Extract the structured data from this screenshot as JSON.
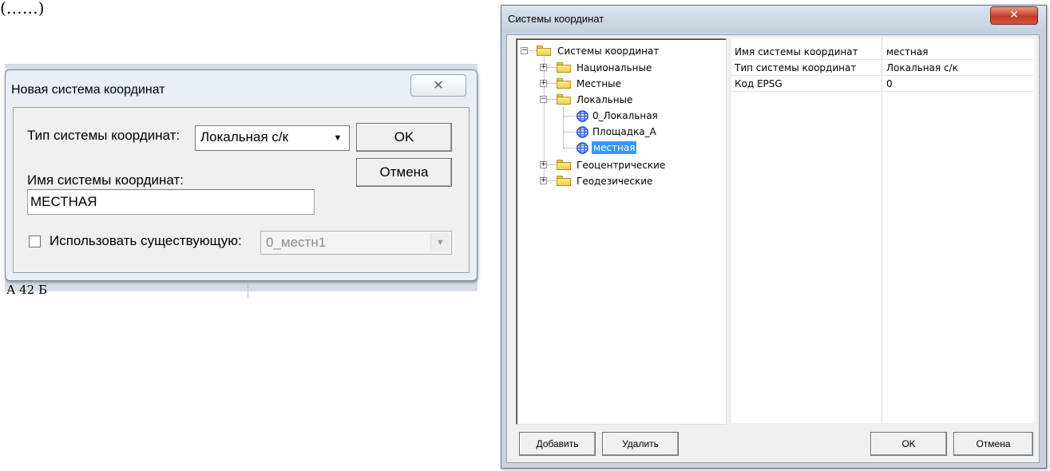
{
  "doc_fragment_top": "(……)",
  "doc_fragment_bottom": "А 42 Б",
  "new_cs_dialog": {
    "title": "Новая система координат",
    "close_glyph": "✕",
    "type_label": "Тип системы координат:",
    "type_value": "Локальная с/к",
    "ok_label": "OK",
    "cancel_label": "Отмена",
    "name_label": "Имя системы координат:",
    "name_value": "МЕСТНАЯ",
    "use_existing_label": "Использовать существующую:",
    "use_existing_checked": false,
    "existing_value": "0_местн1"
  },
  "cs_dialog": {
    "title": "Системы координат",
    "close_glyph": "✕",
    "tree": {
      "root": "Системы координат",
      "national": "Национальные",
      "local_places": "Местные",
      "locals": "Локальные",
      "local_items": [
        "0_Локальная",
        "Площадка_А",
        "местная"
      ],
      "selected_item": "местная",
      "geocentric": "Геоцентрические",
      "geodetic": "Геодезические"
    },
    "properties": [
      {
        "name": "Имя системы координат",
        "value": "местная"
      },
      {
        "name": "Тип системы координат",
        "value": "Локальная с/к"
      },
      {
        "name": "Код EPSG",
        "value": "0"
      }
    ],
    "add_label": "Добавить",
    "delete_label": "Удалить",
    "ok_label": "OK",
    "cancel_label": "Отмена"
  },
  "colors": {
    "selection": "#3399ff",
    "folder": "#f2cf4e",
    "close_red": "#c43b26",
    "globe_blue": "#1d4fd8"
  }
}
